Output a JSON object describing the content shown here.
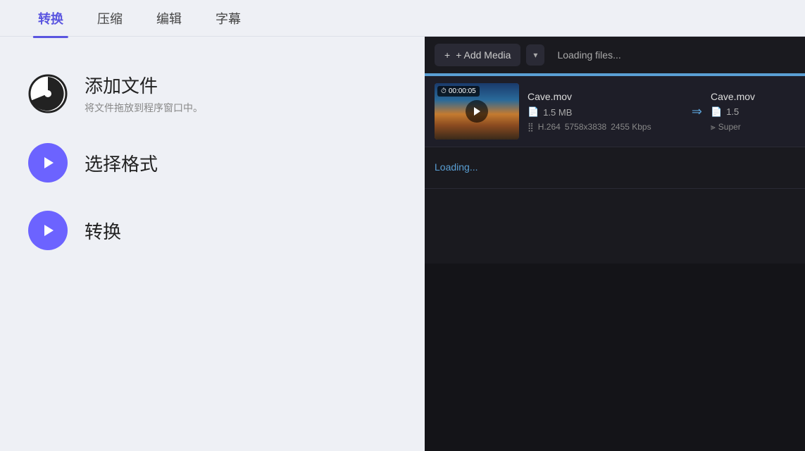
{
  "nav": {
    "tabs": [
      {
        "label": "转换",
        "active": true
      },
      {
        "label": "压缩",
        "active": false
      },
      {
        "label": "编辑",
        "active": false
      },
      {
        "label": "字幕",
        "active": false
      }
    ]
  },
  "steps": [
    {
      "id": "add-file",
      "icon": "clock-ring",
      "title": "添加文件",
      "subtitle": "将文件拖放到程序窗口中。",
      "type": "clock"
    },
    {
      "id": "select-format",
      "icon": "play",
      "title": "选择格式",
      "subtitle": "",
      "type": "play"
    },
    {
      "id": "convert",
      "icon": "play",
      "title": "转换",
      "subtitle": "",
      "type": "play"
    }
  ],
  "media_panel": {
    "add_media_label": "+ Add Media",
    "dropdown_arrow": "▾",
    "loading_status": "Loading files...",
    "progress_width": "100%",
    "file": {
      "duration": "00:00:05",
      "name": "Cave.mov",
      "size": "1.5 MB",
      "codec": "H.264",
      "resolution": "5758x3838",
      "bitrate": "2455 Kbps",
      "output_name": "Cave.mov",
      "output_size": "1.5",
      "output_quality": "Super"
    },
    "loading_text": "Loading..."
  }
}
